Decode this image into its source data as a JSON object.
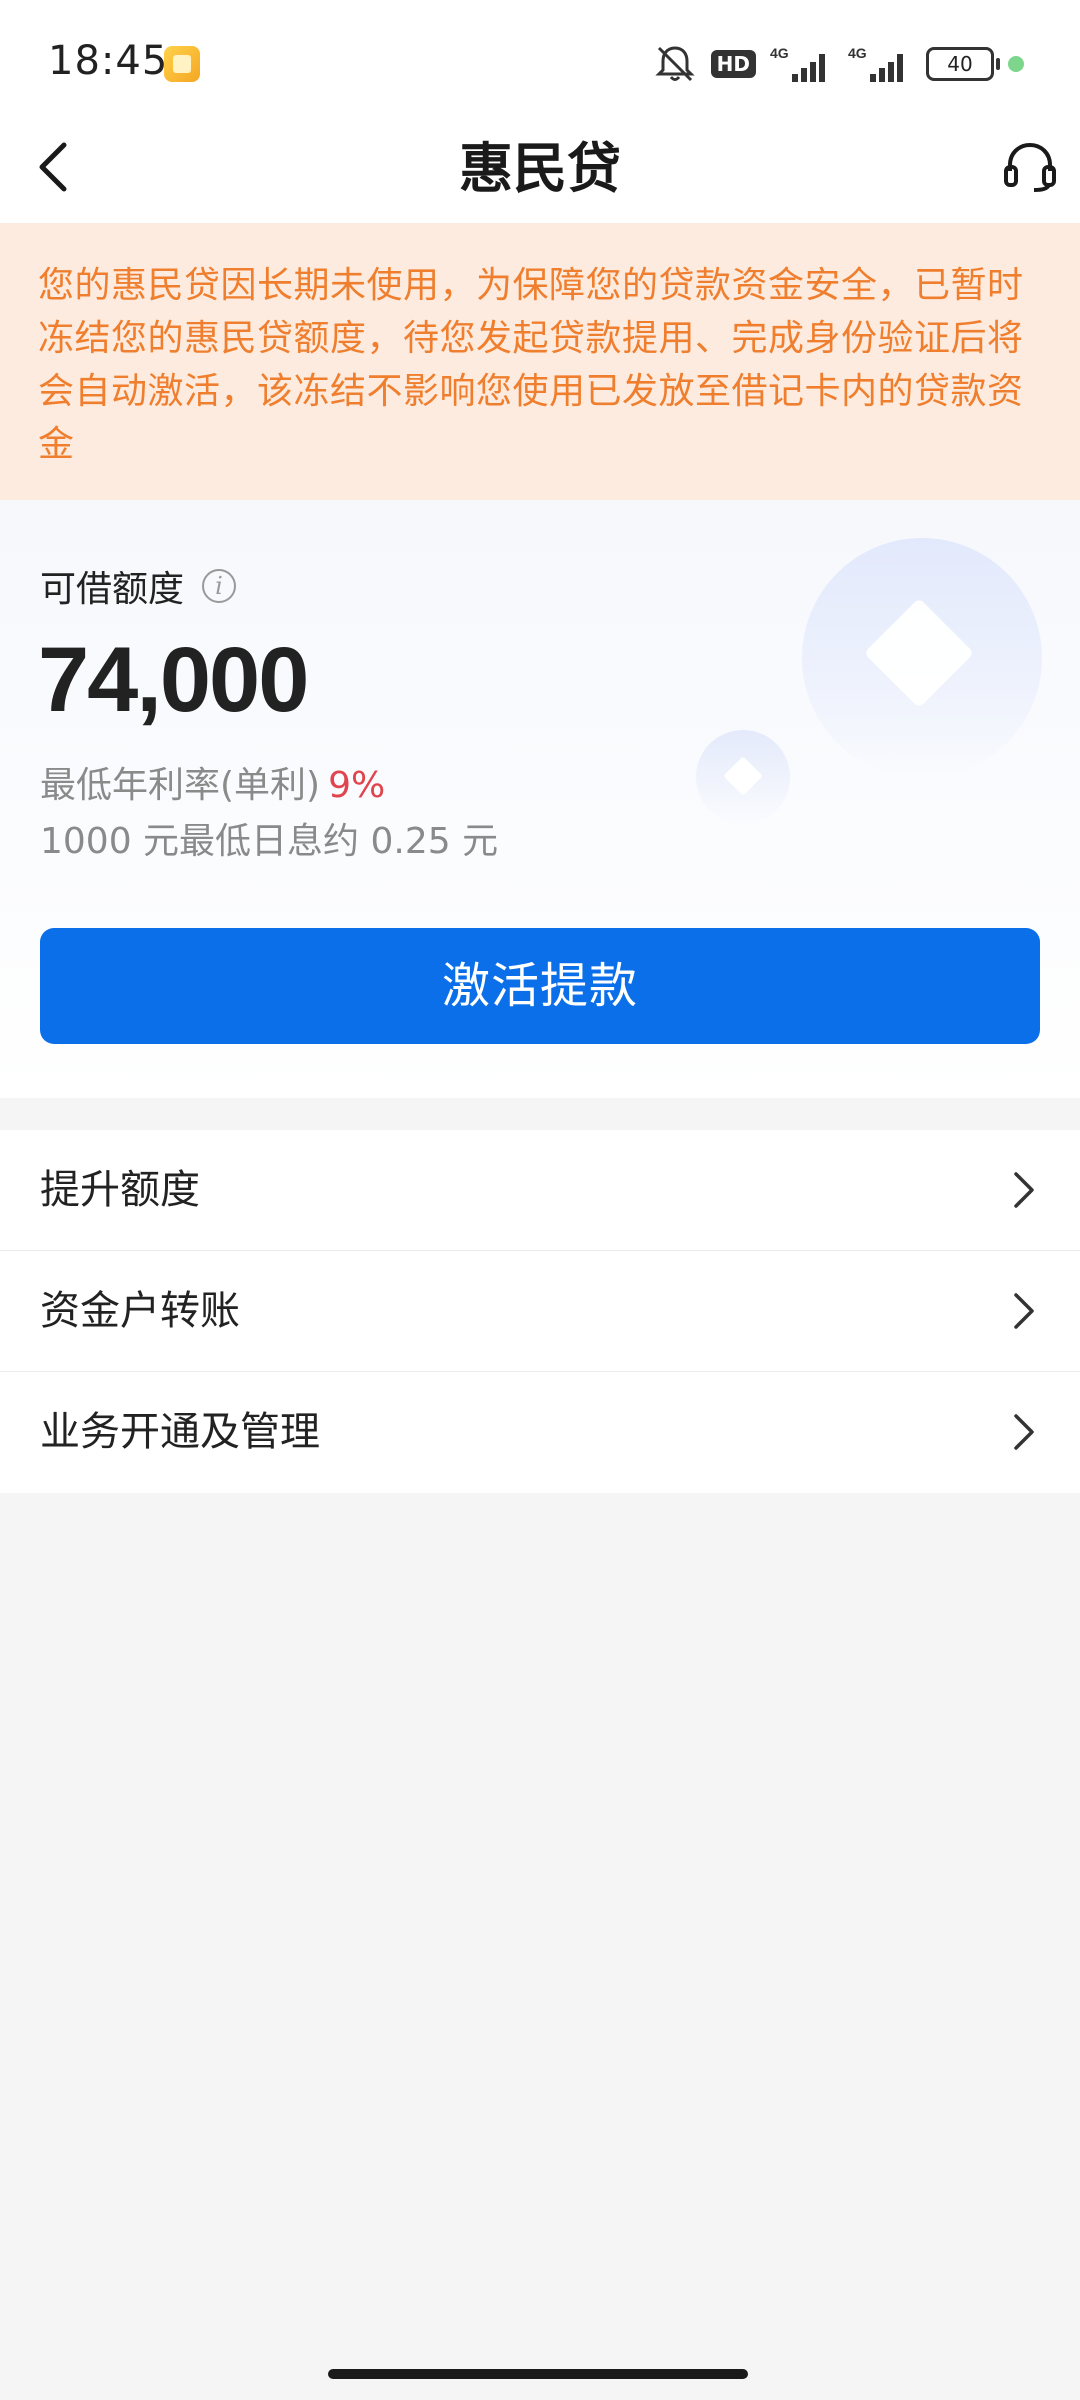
{
  "status_bar": {
    "time": "18:45",
    "network_hd": "HD",
    "network_1": "4G",
    "network_2": "4G",
    "battery": "40"
  },
  "nav": {
    "title": "惠民贷"
  },
  "notice": {
    "text": "您的惠民贷因长期未使用，为保障您的贷款资金安全，已暂时冻结您的惠民贷额度，待您发起贷款提用、完成身份验证后将会自动激活，该冻结不影响您使用已发放至借记卡内的贷款资金"
  },
  "credit": {
    "limit_label": "可借额度",
    "limit_amount": "74,000",
    "rate_label": "最低年利率(单利)",
    "rate_value": "9%",
    "interest_text": "1000 元最低日息约 0.25 元",
    "activate_button": "激活提款"
  },
  "menu": {
    "items": [
      {
        "label": "提升额度"
      },
      {
        "label": "资金户转账"
      },
      {
        "label": "业务开通及管理"
      }
    ]
  },
  "colors": {
    "accent": "#0a6fe8",
    "notice_text": "#ef7f2e",
    "notice_bg": "#fdebdf",
    "rate_red": "#e0444e"
  },
  "icons": {
    "back": "chevron-left-icon",
    "service": "headset-icon",
    "info": "info-icon",
    "menu_arrow": "chevron-right-icon"
  }
}
